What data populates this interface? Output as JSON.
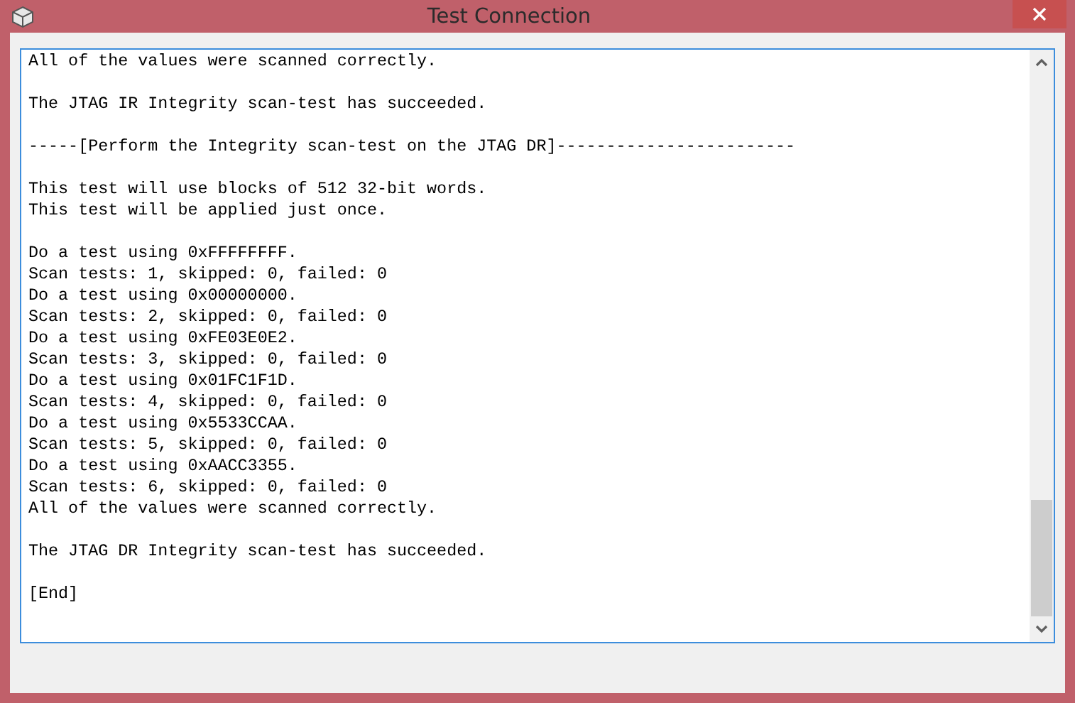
{
  "window": {
    "title": "Test Connection"
  },
  "output": {
    "blocks": [
      [
        "All of the values were scanned correctly."
      ],
      [
        "The JTAG IR Integrity scan-test has succeeded."
      ],
      [
        "-----[Perform the Integrity scan-test on the JTAG DR]------------------------"
      ],
      [
        "This test will use blocks of 512 32-bit words.",
        "This test will be applied just once."
      ],
      [
        "Do a test using 0xFFFFFFFF.",
        "Scan tests: 1, skipped: 0, failed: 0",
        "Do a test using 0x00000000.",
        "Scan tests: 2, skipped: 0, failed: 0",
        "Do a test using 0xFE03E0E2.",
        "Scan tests: 3, skipped: 0, failed: 0",
        "Do a test using 0x01FC1F1D.",
        "Scan tests: 4, skipped: 0, failed: 0",
        "Do a test using 0x5533CCAA.",
        "Scan tests: 5, skipped: 0, failed: 0",
        "Do a test using 0xAACC3355.",
        "Scan tests: 6, skipped: 0, failed: 0",
        "All of the values were scanned correctly."
      ],
      [
        "The JTAG DR Integrity scan-test has succeeded."
      ],
      [
        "[End]"
      ]
    ]
  }
}
